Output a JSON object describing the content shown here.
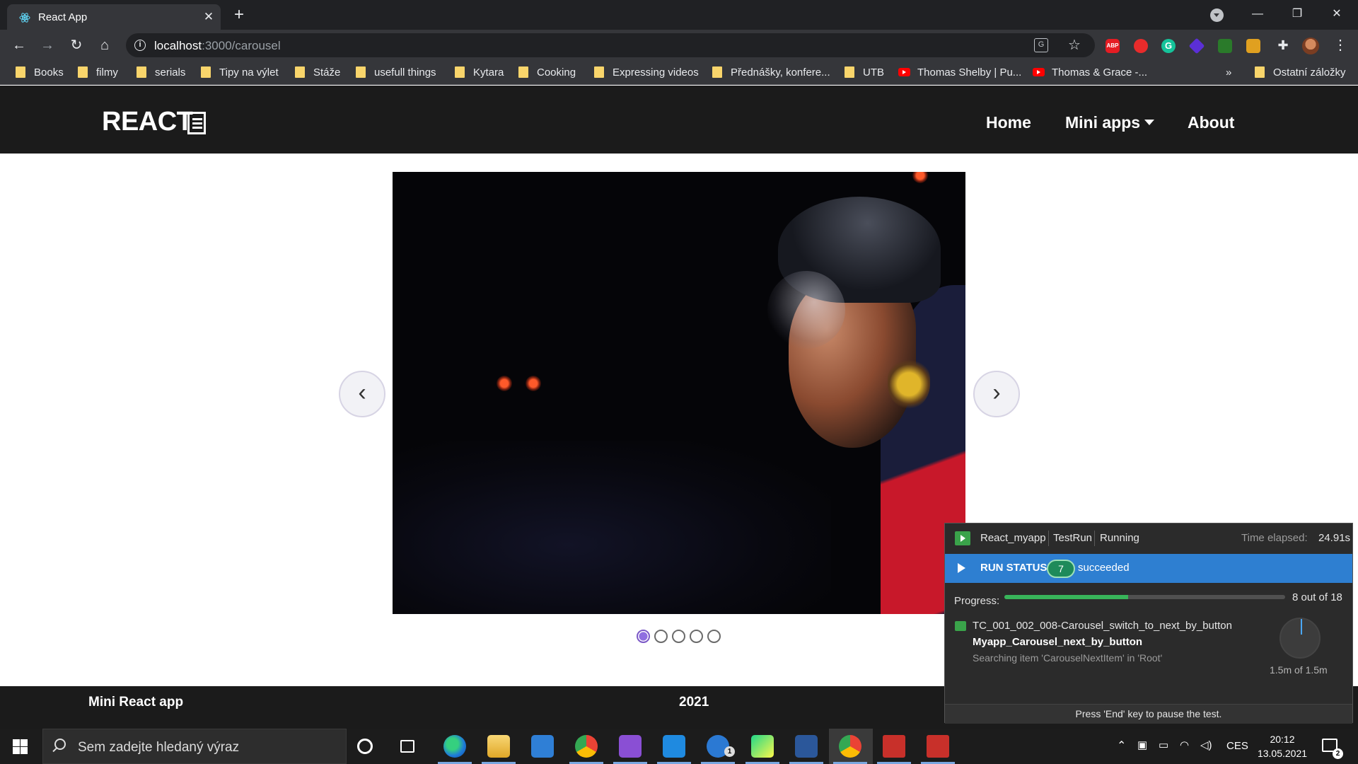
{
  "browser": {
    "tab_title": "React App",
    "url_host": "localhost",
    "url_path": ":3000/carousel",
    "bookmarks": [
      {
        "label": "Books",
        "icon": "folder-icon"
      },
      {
        "label": "filmy",
        "icon": "folder-icon"
      },
      {
        "label": "serials",
        "icon": "folder-icon"
      },
      {
        "label": "Tipy na výlet",
        "icon": "folder-icon"
      },
      {
        "label": "Stáže",
        "icon": "folder-icon"
      },
      {
        "label": "usefull things",
        "icon": "folder-icon"
      },
      {
        "label": "Kytara",
        "icon": "folder-icon"
      },
      {
        "label": "Cooking",
        "icon": "folder-icon"
      },
      {
        "label": "Expressing videos",
        "icon": "folder-icon"
      },
      {
        "label": "Přednášky, konfere...",
        "icon": "folder-icon"
      },
      {
        "label": "UTB",
        "icon": "folder-icon"
      },
      {
        "label": "Thomas Shelby | Pu...",
        "icon": "youtube-icon"
      },
      {
        "label": "Thomas & Grace -...",
        "icon": "youtube-icon"
      }
    ],
    "bookmarks_overflow": "»",
    "other_bookmarks": "Ostatní záložky"
  },
  "navbar": {
    "brand": "REACT",
    "links": {
      "home": "Home",
      "mini_apps": "Mini apps",
      "about": "About"
    }
  },
  "carousel": {
    "prev_label": "‹",
    "next_label": "›",
    "slide_count": 5,
    "active_index": 0
  },
  "footer": {
    "left": "Mini React app",
    "center": "2021"
  },
  "test_runner": {
    "project": "React_myapp",
    "run_name": "TestRun",
    "state": "Running",
    "elapsed_label": "Time elapsed:",
    "elapsed": "24.91s",
    "status_label": "RUN STATUS",
    "succeeded_count": "7",
    "succeeded_label": "succeeded",
    "progress_label": "Progress:",
    "progress_fraction": 0.44,
    "progress_text": "8 out of 18",
    "test_case": "TC_001_002_008-Carousel_switch_to_next_by_button",
    "module": "Myapp_Carousel_next_by_button",
    "action": "Searching item 'CarouselNextItem' in 'Root'",
    "timeout": "1.5m of 1.5m",
    "footer_hint": "Press 'End' key to pause the test."
  },
  "taskbar": {
    "search_placeholder": "Sem zadejte hledaný výraz",
    "todo_badge": "1",
    "language": "CES",
    "time": "20:12",
    "date": "13.05.2021",
    "notification_count": "2"
  }
}
